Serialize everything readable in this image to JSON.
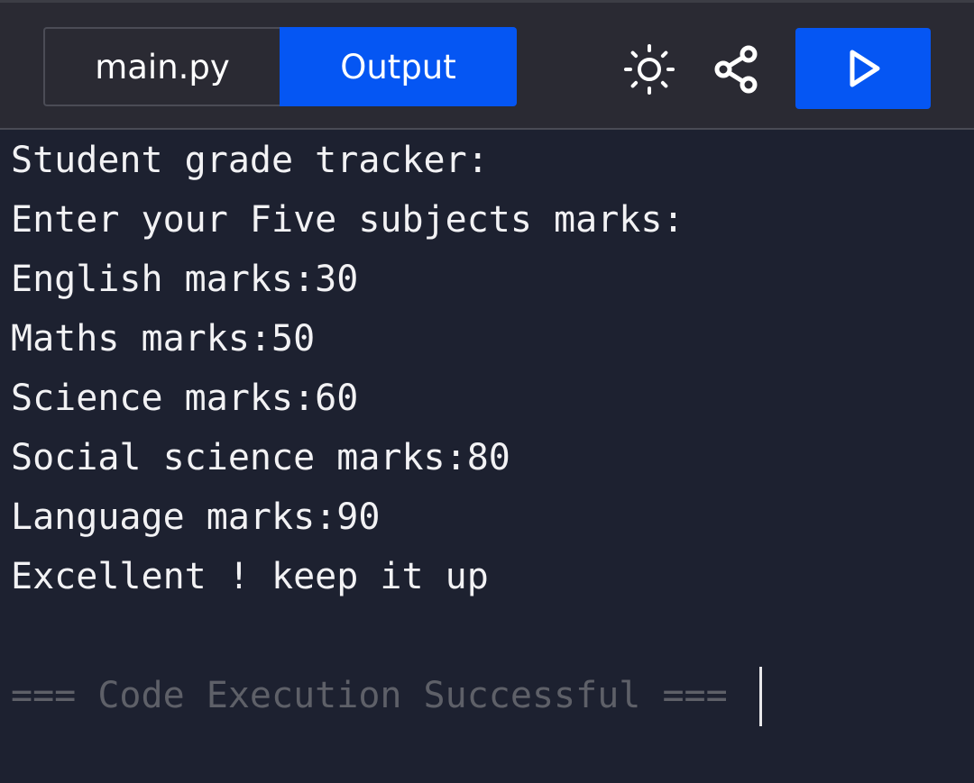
{
  "tabs": {
    "file_label": "main.py",
    "output_label": "Output"
  },
  "toolbar": {
    "theme_icon": "sun-icon",
    "share_icon": "share-icon",
    "run_icon": "play-icon"
  },
  "colors": {
    "accent": "#0556f3",
    "toolbar_bg": "#2a2a33",
    "console_bg": "#1d2130",
    "text": "#f2f2f4",
    "dim_text": "#5e6068"
  },
  "console": {
    "lines": [
      "Student grade tracker:",
      "Enter your Five subjects marks:",
      "English marks:30",
      "Maths marks:50",
      "Science marks:60",
      "Social science marks:80",
      "Language marks:90",
      "Excellent ! keep it up"
    ],
    "status": "=== Code Execution Successful ==="
  }
}
